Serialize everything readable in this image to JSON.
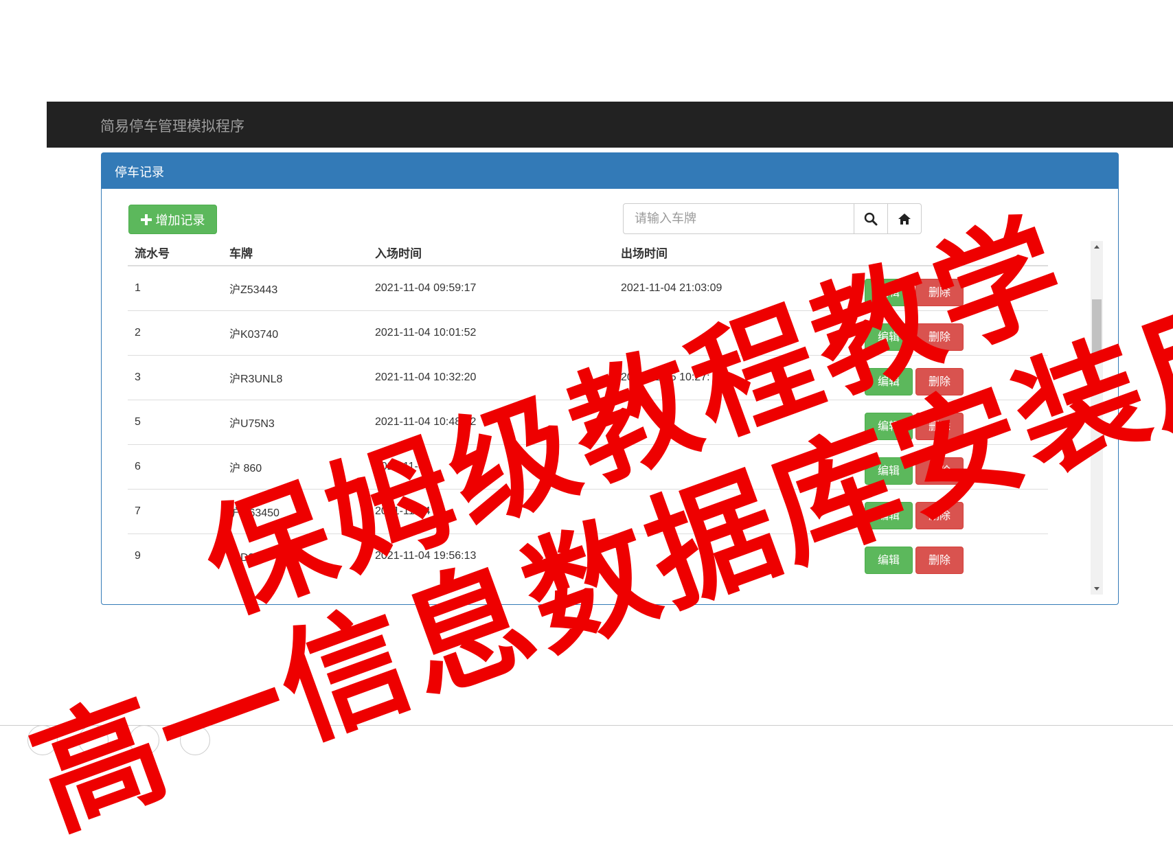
{
  "navbar": {
    "brand": "简易停车管理模拟程序"
  },
  "panel": {
    "title": "停车记录"
  },
  "toolbar": {
    "add_label": "增加记录",
    "search_placeholder": "请输入车牌"
  },
  "table": {
    "headers": [
      "流水号",
      "车牌",
      "入场时间",
      "出场时间",
      ""
    ],
    "rows": [
      {
        "id": "1",
        "plate": "沪Z53443",
        "in": "2021-11-04 09:59:17",
        "out": "2021-11-04 21:03:09"
      },
      {
        "id": "2",
        "plate": "沪K03740",
        "in": "2021-11-04 10:01:52",
        "out": ""
      },
      {
        "id": "3",
        "plate": "沪R3UNL8",
        "in": "2021-11-04 10:32:20",
        "out": "2021-11-05 10:27:"
      },
      {
        "id": "5",
        "plate": "沪U75N3",
        "in": "2021-11-04 10:48:32",
        "out": ""
      },
      {
        "id": "6",
        "plate": "沪  860",
        "in": "2021-11-04",
        "out": ""
      },
      {
        "id": "7",
        "plate": "沪G63450",
        "in": "2021-11-04 1",
        "out": ""
      },
      {
        "id": "9",
        "plate": "沪D8  2",
        "in": "2021-11-04 19:56:13",
        "out": ""
      }
    ],
    "edit_label": "编辑",
    "delete_label": "删除"
  },
  "overlay": {
    "line1": "保姆级教程教学",
    "line2": "高一信息数据库安装用法"
  },
  "colors": {
    "navbar": "#222222",
    "panel_primary": "#337ab7",
    "success": "#5cb85c",
    "danger": "#d9534f",
    "overlay_text": "#ee0000"
  }
}
